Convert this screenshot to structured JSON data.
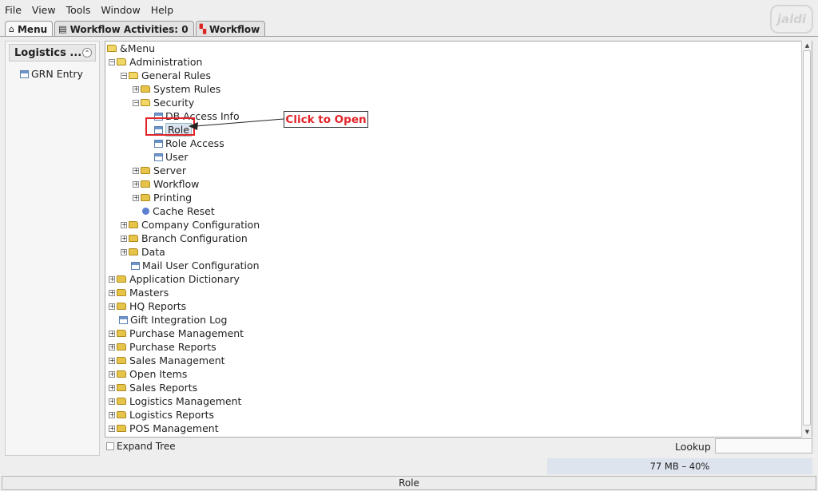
{
  "menubar": {
    "file": "File",
    "view": "View",
    "tools": "Tools",
    "window": "Window",
    "help": "Help"
  },
  "logo": "jaldi",
  "tabs": [
    {
      "label": "Menu",
      "icon": "home-icon",
      "active": true
    },
    {
      "label": "Workflow Activities: 0",
      "icon": "table-icon"
    },
    {
      "label": "Workflow",
      "icon": "workflow-icon"
    }
  ],
  "left_panel": {
    "header": "Logistics ...",
    "items": [
      {
        "label": "GRN Entry"
      }
    ]
  },
  "tree": {
    "root": "&Menu",
    "administration": "Administration",
    "general_rules": "General Rules",
    "system_rules": "System Rules",
    "security": "Security",
    "db_access_info": "DB Access Info",
    "role": "Role",
    "role_access": "Role Access",
    "user": "User",
    "server": "Server",
    "workflow": "Workflow",
    "printing": "Printing",
    "cache_reset": "Cache Reset",
    "company_configuration": "Company Configuration",
    "branch_configuration": "Branch Configuration",
    "data": "Data",
    "mail_user_configuration": "Mail User Configuration",
    "application_dictionary": "Application Dictionary",
    "masters": "Masters",
    "hq_reports": "HQ Reports",
    "gift_integration_log": "Gift Integration Log",
    "purchase_management": "Purchase Management",
    "purchase_reports": "Purchase Reports",
    "sales_management": "Sales Management",
    "open_items": "Open Items",
    "sales_reports": "Sales Reports",
    "logistics_management": "Logistics Management",
    "logistics_reports": "Logistics Reports",
    "pos_management": "POS Management"
  },
  "annotation": {
    "callout": "Click to Open",
    "color": "#e2242a"
  },
  "bottom": {
    "expand_tree": "Expand Tree",
    "lookup": "Lookup",
    "lookup_value": ""
  },
  "memory": "77 MB – 40%",
  "status": "Role"
}
